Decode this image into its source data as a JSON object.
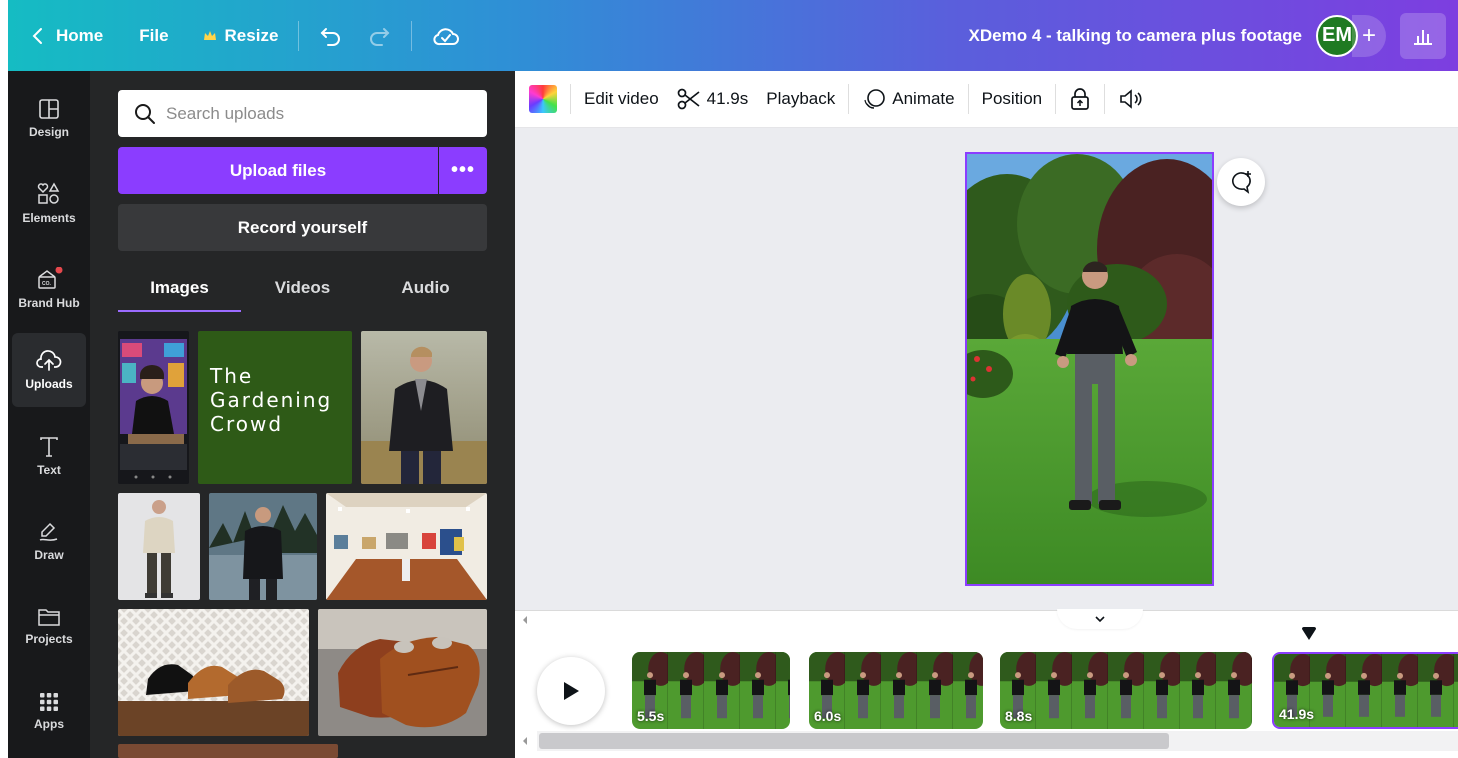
{
  "topbar": {
    "home_label": "Home",
    "file_label": "File",
    "resize_label": "Resize",
    "doc_title": "XDemo 4 - talking to camera plus footage",
    "avatar_initials": "EM",
    "gradient_colors": [
      "#15bcc3",
      "#5a5fdc",
      "#7d3ee0"
    ]
  },
  "rail": {
    "items": [
      {
        "label": "Design",
        "icon": "layout-icon"
      },
      {
        "label": "Elements",
        "icon": "shapes-icon"
      },
      {
        "label": "Brand Hub",
        "icon": "brand-hub-icon"
      },
      {
        "label": "Uploads",
        "icon": "cloud-upload-icon"
      },
      {
        "label": "Text",
        "icon": "text-icon"
      },
      {
        "label": "Draw",
        "icon": "draw-icon"
      },
      {
        "label": "Projects",
        "icon": "folder-icon"
      },
      {
        "label": "Apps",
        "icon": "apps-grid-icon"
      }
    ],
    "active": "Uploads"
  },
  "panel": {
    "search_placeholder": "Search uploads",
    "upload_label": "Upload files",
    "record_label": "Record yourself",
    "tabs": [
      "Images",
      "Videos",
      "Audio"
    ],
    "active_tab": "Images",
    "gardening_text": "The Gardening Crowd",
    "accent_color": "#8b3dff"
  },
  "toolbar": {
    "edit_video_label": "Edit video",
    "duration_label": "41.9s",
    "playback_label": "Playback",
    "animate_label": "Animate",
    "position_label": "Position"
  },
  "timeline": {
    "clips": [
      {
        "duration": "5.5s"
      },
      {
        "duration": "6.0s"
      },
      {
        "duration": "8.8s"
      },
      {
        "duration": "41.9s"
      }
    ]
  }
}
